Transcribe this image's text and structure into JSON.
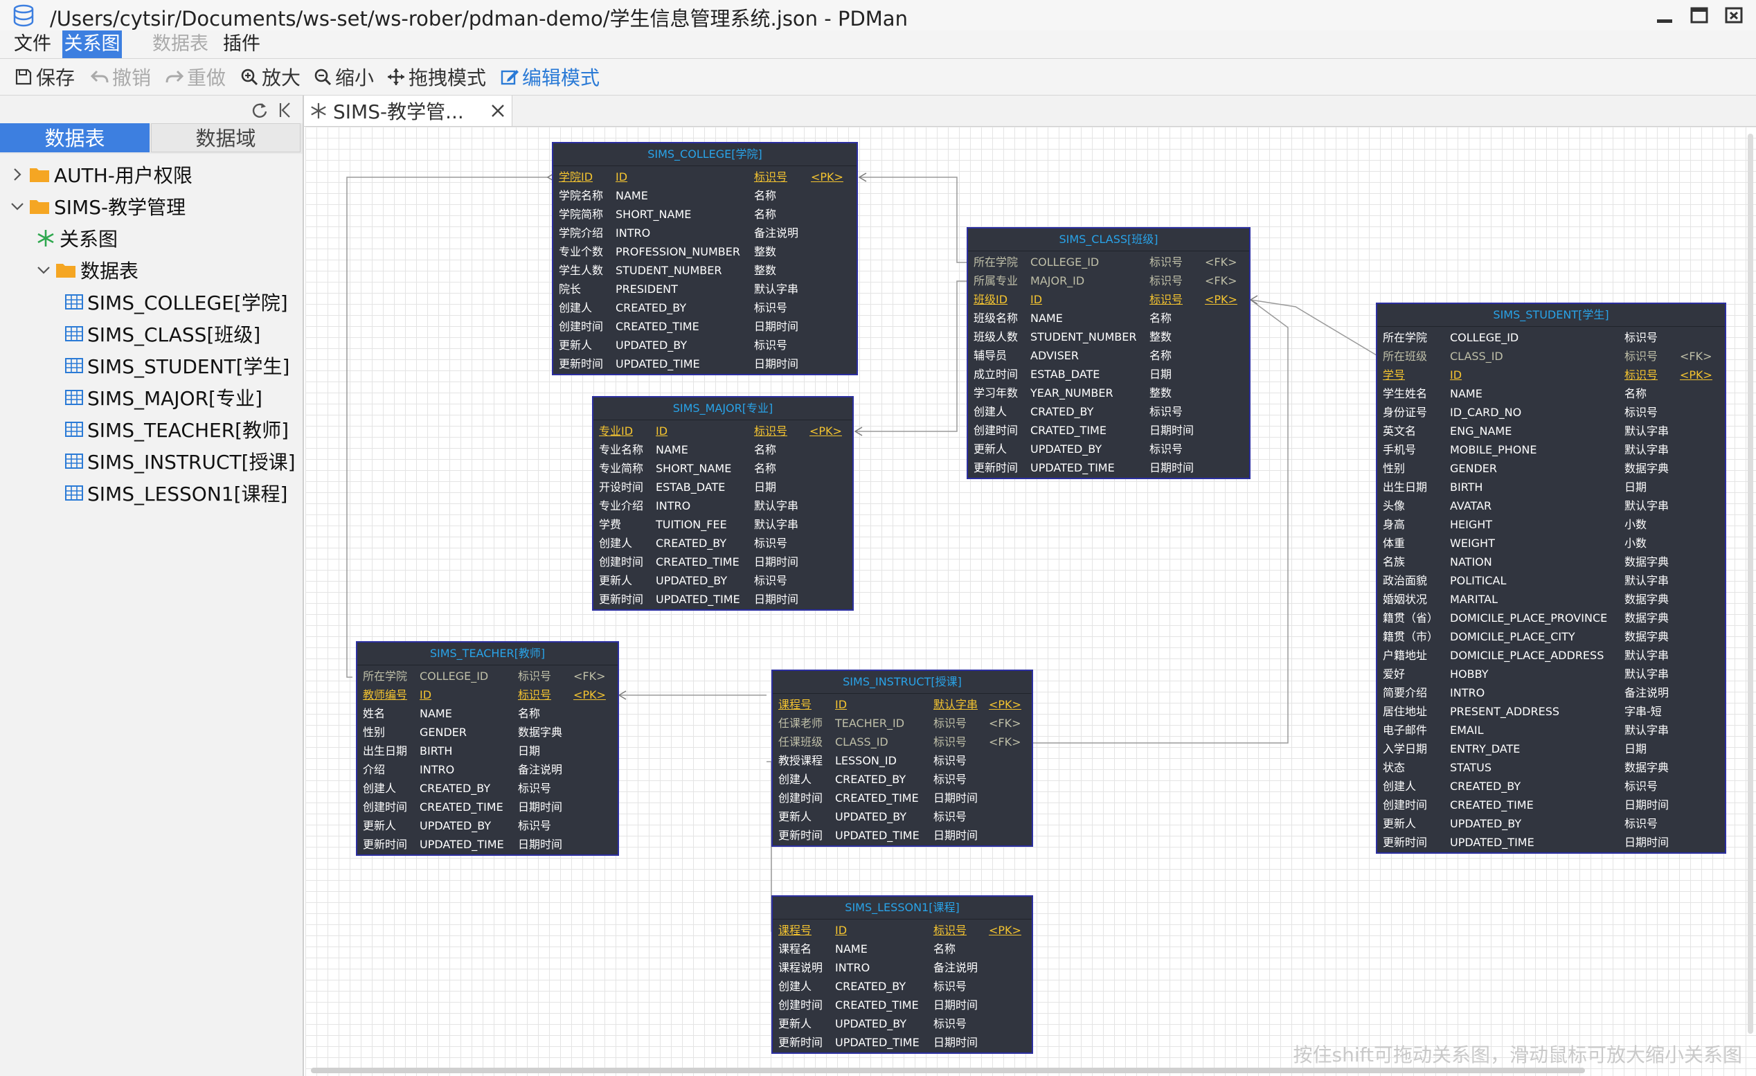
{
  "window": {
    "title": "/Users/cytsir/Documents/ws-set/ws-rober/pdman-demo/学生信息管理系统.json - PDMan"
  },
  "menu": [
    {
      "label": "文件",
      "state": "normal"
    },
    {
      "label": "关系图",
      "state": "active"
    },
    {
      "label": "数据表",
      "state": "disabled"
    },
    {
      "label": "插件",
      "state": "normal"
    }
  ],
  "toolbar": {
    "save": "保存",
    "undo": "撤销",
    "redo": "重做",
    "zoom_in": "放大",
    "zoom_out": "缩小",
    "drag_mode": "拖拽模式",
    "edit_mode": "编辑模式"
  },
  "sidebar": {
    "tabs": [
      "数据表",
      "数据域"
    ],
    "tree": {
      "group1": "AUTH-用户权限",
      "group2": "SIMS-教学管理",
      "diagram": "关系图",
      "tables_folder": "数据表",
      "tables": [
        "SIMS_COLLEGE[学院]",
        "SIMS_CLASS[班级]",
        "SIMS_STUDENT[学生]",
        "SIMS_MAJOR[专业]",
        "SIMS_TEACHER[教师]",
        "SIMS_INSTRUCT[授课]",
        "SIMS_LESSON1[课程]"
      ]
    }
  },
  "doc_tab": {
    "label": "SIMS-教学管..."
  },
  "canvas": {
    "hint": "按住shift可拖动关系图，滑动鼠标可放大缩小关系图"
  },
  "colors": {
    "accent": "#3d7fe0",
    "entity_bg": "#31353f",
    "entity_border": "#2c2fa0",
    "entity_title": "#29a3e8",
    "pk_field": "#f4c430",
    "fk_field": "#bfbfa8"
  },
  "entities": [
    {
      "title": "SIMS_COLLEGE[学院]",
      "fields": [
        [
          "学院ID",
          "ID",
          "标识号",
          "<PK>",
          "pk"
        ],
        [
          "学院名称",
          "NAME",
          "名称",
          "",
          ""
        ],
        [
          "学院简称",
          "SHORT_NAME",
          "名称",
          "",
          ""
        ],
        [
          "学院介绍",
          "INTRO",
          "备注说明",
          "",
          ""
        ],
        [
          "专业个数",
          "PROFESSION_NUMBER",
          "整数",
          "",
          ""
        ],
        [
          "学生人数",
          "STUDENT_NUMBER",
          "整数",
          "",
          ""
        ],
        [
          "院长",
          "PRESIDENT",
          "默认字串",
          "",
          ""
        ],
        [
          "创建人",
          "CREATED_BY",
          "标识号",
          "",
          ""
        ],
        [
          "创建时间",
          "CREATED_TIME",
          "日期时间",
          "",
          ""
        ],
        [
          "更新人",
          "UPDATED_BY",
          "标识号",
          "",
          ""
        ],
        [
          "更新时间",
          "UPDATED_TIME",
          "日期时间",
          "",
          ""
        ]
      ]
    },
    {
      "title": "SIMS_MAJOR[专业]",
      "fields": [
        [
          "专业ID",
          "ID",
          "标识号",
          "<PK>",
          "pk"
        ],
        [
          "专业名称",
          "NAME",
          "名称",
          "",
          ""
        ],
        [
          "专业简称",
          "SHORT_NAME",
          "名称",
          "",
          ""
        ],
        [
          "开设时间",
          "ESTAB_DATE",
          "日期",
          "",
          ""
        ],
        [
          "专业介绍",
          "INTRO",
          "默认字串",
          "",
          ""
        ],
        [
          "学费",
          "TUITION_FEE",
          "默认字串",
          "",
          ""
        ],
        [
          "创建人",
          "CREATED_BY",
          "标识号",
          "",
          ""
        ],
        [
          "创建时间",
          "CREATED_TIME",
          "日期时间",
          "",
          ""
        ],
        [
          "更新人",
          "UPDATED_BY",
          "标识号",
          "",
          ""
        ],
        [
          "更新时间",
          "UPDATED_TIME",
          "日期时间",
          "",
          ""
        ]
      ]
    },
    {
      "title": "SIMS_CLASS[班级]",
      "fields": [
        [
          "所在学院",
          "COLLEGE_ID",
          "标识号",
          "<FK>",
          "fk"
        ],
        [
          "所属专业",
          "MAJOR_ID",
          "标识号",
          "<FK>",
          "fk"
        ],
        [
          "班级ID",
          "ID",
          "标识号",
          "<PK>",
          "pk"
        ],
        [
          "班级名称",
          "NAME",
          "名称",
          "",
          ""
        ],
        [
          "班级人数",
          "STUDENT_NUMBER",
          "整数",
          "",
          ""
        ],
        [
          "辅导员",
          "ADVISER",
          "名称",
          "",
          ""
        ],
        [
          "成立时间",
          "ESTAB_DATE",
          "日期",
          "",
          ""
        ],
        [
          "学习年数",
          "YEAR_NUMBER",
          "整数",
          "",
          ""
        ],
        [
          "创建人",
          "CRATED_BY",
          "标识号",
          "",
          ""
        ],
        [
          "创建时间",
          "CRATED_TIME",
          "日期时间",
          "",
          ""
        ],
        [
          "更新人",
          "UPDATED_BY",
          "标识号",
          "",
          ""
        ],
        [
          "更新时间",
          "UPDATED_TIME",
          "日期时间",
          "",
          ""
        ]
      ]
    },
    {
      "title": "SIMS_STUDENT[学生]",
      "fields": [
        [
          "所在学院",
          "COLLEGE_ID",
          "标识号",
          "",
          ""
        ],
        [
          "所在班级",
          "CLASS_ID",
          "标识号",
          "<FK>",
          "fk"
        ],
        [
          "学号",
          "ID",
          "标识号",
          "<PK>",
          "pk"
        ],
        [
          "学生姓名",
          "NAME",
          "名称",
          "",
          ""
        ],
        [
          "身份证号",
          "ID_CARD_NO",
          "标识号",
          "",
          ""
        ],
        [
          "英文名",
          "ENG_NAME",
          "默认字串",
          "",
          ""
        ],
        [
          "手机号",
          "MOBILE_PHONE",
          "默认字串",
          "",
          ""
        ],
        [
          "性别",
          "GENDER",
          "数据字典",
          "",
          ""
        ],
        [
          "出生日期",
          "BIRTH",
          "日期",
          "",
          ""
        ],
        [
          "头像",
          "AVATAR",
          "默认字串",
          "",
          ""
        ],
        [
          "身高",
          "HEIGHT",
          "小数",
          "",
          ""
        ],
        [
          "体重",
          "WEIGHT",
          "小数",
          "",
          ""
        ],
        [
          "名族",
          "NATION",
          "数据字典",
          "",
          ""
        ],
        [
          "政治面貌",
          "POLITICAL",
          "默认字串",
          "",
          ""
        ],
        [
          "婚姻状况",
          "MARITAL",
          "数据字典",
          "",
          ""
        ],
        [
          "籍贯（省）",
          "DOMICILE_PLACE_PROVINCE",
          "数据字典",
          "",
          ""
        ],
        [
          "籍贯（市）",
          "DOMICILE_PLACE_CITY",
          "数据字典",
          "",
          ""
        ],
        [
          "户籍地址",
          "DOMICILE_PLACE_ADDRESS",
          "默认字串",
          "",
          ""
        ],
        [
          "爱好",
          "HOBBY",
          "默认字串",
          "",
          ""
        ],
        [
          "简要介绍",
          "INTRO",
          "备注说明",
          "",
          ""
        ],
        [
          "居住地址",
          "PRESENT_ADDRESS",
          "字串-短",
          "",
          ""
        ],
        [
          "电子邮件",
          "EMAIL",
          "默认字串",
          "",
          ""
        ],
        [
          "入学日期",
          "ENTRY_DATE",
          "日期",
          "",
          ""
        ],
        [
          "状态",
          "STATUS",
          "数据字典",
          "",
          ""
        ],
        [
          "创建人",
          "CREATED_BY",
          "标识号",
          "",
          ""
        ],
        [
          "创建时间",
          "CREATED_TIME",
          "日期时间",
          "",
          ""
        ],
        [
          "更新人",
          "UPDATED_BY",
          "标识号",
          "",
          ""
        ],
        [
          "更新时间",
          "UPDATED_TIME",
          "日期时间",
          "",
          ""
        ]
      ]
    },
    {
      "title": "SIMS_TEACHER[教师]",
      "fields": [
        [
          "所在学院",
          "COLLEGE_ID",
          "标识号",
          "<FK>",
          "fk"
        ],
        [
          "教师编号",
          "ID",
          "标识号",
          "<PK>",
          "pk"
        ],
        [
          "姓名",
          "NAME",
          "名称",
          "",
          ""
        ],
        [
          "性别",
          "GENDER",
          "数据字典",
          "",
          ""
        ],
        [
          "出生日期",
          "BIRTH",
          "日期",
          "",
          ""
        ],
        [
          "介绍",
          "INTRO",
          "备注说明",
          "",
          ""
        ],
        [
          "创建人",
          "CREATED_BY",
          "标识号",
          "",
          ""
        ],
        [
          "创建时间",
          "CREATED_TIME",
          "日期时间",
          "",
          ""
        ],
        [
          "更新人",
          "UPDATED_BY",
          "标识号",
          "",
          ""
        ],
        [
          "更新时间",
          "UPDATED_TIME",
          "日期时间",
          "",
          ""
        ]
      ]
    },
    {
      "title": "SIMS_INSTRUCT[授课]",
      "fields": [
        [
          "课程号",
          "ID",
          "默认字串",
          "<PK>",
          "pk"
        ],
        [
          "任课老师",
          "TEACHER_ID",
          "标识号",
          "<FK>",
          "fk"
        ],
        [
          "任课班级",
          "CLASS_ID",
          "标识号",
          "<FK>",
          "fk"
        ],
        [
          "教授课程",
          "LESSON_ID",
          "标识号",
          "",
          ""
        ],
        [
          "创建人",
          "CREATED_BY",
          "标识号",
          "",
          ""
        ],
        [
          "创建时间",
          "CREATED_TIME",
          "日期时间",
          "",
          ""
        ],
        [
          "更新人",
          "UPDATED_BY",
          "标识号",
          "",
          ""
        ],
        [
          "更新时间",
          "UPDATED_TIME",
          "日期时间",
          "",
          ""
        ]
      ]
    },
    {
      "title": "SIMS_LESSON1[课程]",
      "fields": [
        [
          "课程号",
          "ID",
          "标识号",
          "<PK>",
          "pk"
        ],
        [
          "课程名",
          "NAME",
          "名称",
          "",
          ""
        ],
        [
          "课程说明",
          "INTRO",
          "备注说明",
          "",
          ""
        ],
        [
          "创建人",
          "CREATED_BY",
          "标识号",
          "",
          ""
        ],
        [
          "创建时间",
          "CREATED_TIME",
          "日期时间",
          "",
          ""
        ],
        [
          "更新人",
          "UPDATED_BY",
          "标识号",
          "",
          ""
        ],
        [
          "更新时间",
          "UPDATED_TIME",
          "日期时间",
          "",
          ""
        ]
      ]
    }
  ]
}
